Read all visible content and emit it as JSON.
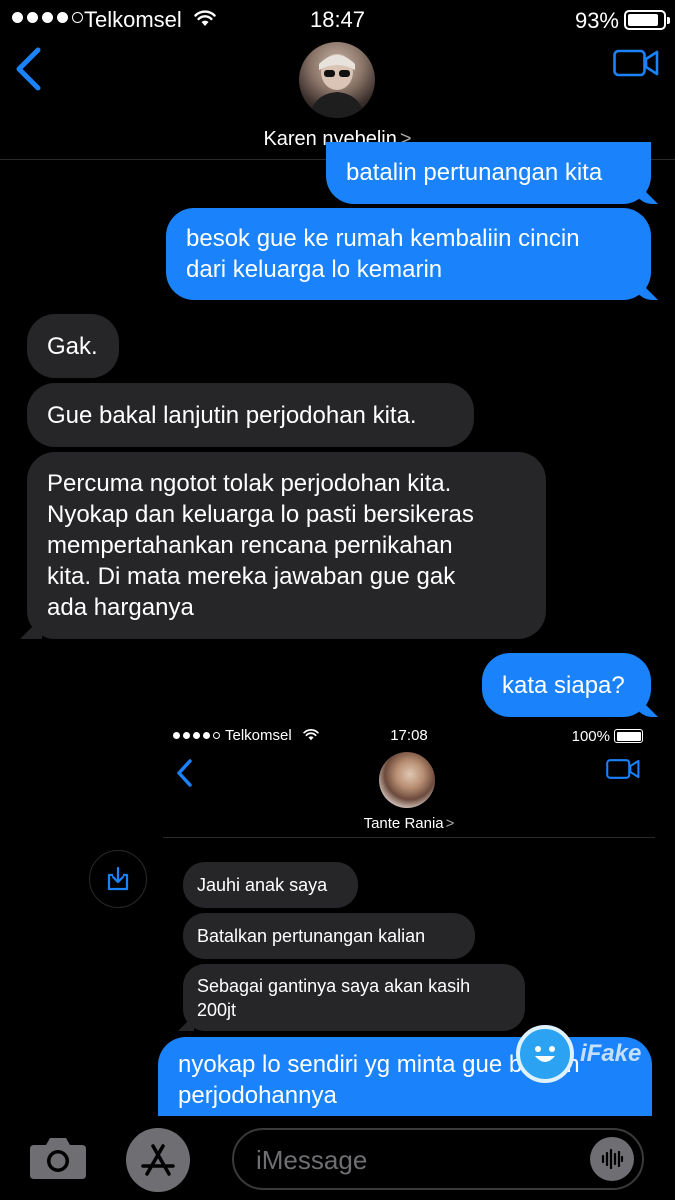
{
  "status_bar": {
    "carrier": "Telkomsel",
    "time": "18:47",
    "battery": "93%",
    "battery_level": 0.93
  },
  "header": {
    "contact_name": "Karen nyebelin",
    "chevron": ">"
  },
  "messages": [
    {
      "direction": "sent",
      "text": "batalin pertunangan kita"
    },
    {
      "direction": "sent",
      "text_lines": [
        "besok gue ke rumah kembaliin cincin",
        "dari keluarga lo kemarin"
      ]
    },
    {
      "direction": "received",
      "text": "Gak."
    },
    {
      "direction": "received",
      "text": "Gue bakal lanjutin perjodohan kita."
    },
    {
      "direction": "received",
      "text_lines": [
        "Percuma ngotot tolak perjodohan kita.",
        "Nyokap dan keluarga lo pasti bersikeras",
        "mempertahankan rencana pernikahan",
        "kita. Di mata mereka jawaban gue gak",
        "ada harganya"
      ]
    },
    {
      "direction": "sent",
      "text": "kata siapa?"
    }
  ],
  "embedded_screenshot": {
    "carrier": "Telkomsel",
    "time": "17:08",
    "battery": "100%",
    "contact_name": "Tante Rania",
    "chevron": ">",
    "messages": [
      {
        "direction": "received",
        "text": "Jauhi anak saya"
      },
      {
        "direction": "received",
        "text": "Batalkan pertunangan kalian"
      },
      {
        "direction": "received",
        "text_lines": [
          "Sebagai gantinya saya akan kasih",
          "200jt"
        ]
      }
    ]
  },
  "last_message": {
    "direction": "sent",
    "text_lines": [
      "nyokap lo sendiri yg minta gue batalin",
      "perjodohannya"
    ]
  },
  "watermark": "iFake",
  "input_bar": {
    "placeholder": "iMessage"
  },
  "colors": {
    "sent_bubble": "#1a82fb",
    "received_bubble": "#262629",
    "accent": "#1a82fb",
    "background": "#000000"
  }
}
